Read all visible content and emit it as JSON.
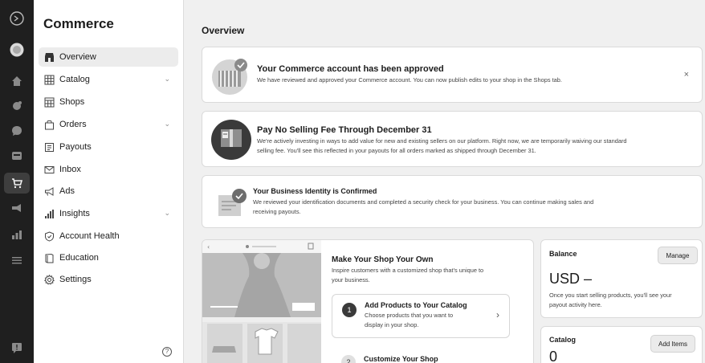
{
  "nav": {
    "title": "Commerce",
    "items": [
      {
        "label": "Overview",
        "icon": "store-icon"
      },
      {
        "label": "Catalog",
        "icon": "grid-icon"
      },
      {
        "label": "Shops",
        "icon": "shop-grid-icon"
      },
      {
        "label": "Orders",
        "icon": "bag-icon"
      },
      {
        "label": "Payouts",
        "icon": "payouts-icon"
      },
      {
        "label": "Inbox",
        "icon": "mail-icon"
      },
      {
        "label": "Ads",
        "icon": "megaphone-icon"
      },
      {
        "label": "Insights",
        "icon": "bar-chart-icon"
      },
      {
        "label": "Account Health",
        "icon": "shield-icon"
      },
      {
        "label": "Education",
        "icon": "book-icon"
      },
      {
        "label": "Settings",
        "icon": "gear-icon"
      }
    ],
    "help_glyph": "?"
  },
  "main": {
    "title": "Overview",
    "approved": {
      "title": "Your Commerce account has been approved",
      "body": "We have reviewed and approved your Commerce account. You can now publish edits to your shop in the Shops tab.",
      "close": "×"
    },
    "fee": {
      "title": "Pay No Selling Fee Through December 31",
      "body1": "We're actively investing in ways to add value for new and existing sellers on our platform. Right now, we are temporarily waiving our standard",
      "body2": "selling fee. You'll see this reflected in your payouts for all orders marked as shipped through December 31."
    },
    "identity": {
      "title": "Your Business Identity is Confirmed",
      "body1": "We reviewed your identification documents and completed a security check for your business. You can continue making sales and",
      "body2": "receiving payouts."
    },
    "shop": {
      "title": "Make Your Shop Your Own",
      "body1": "Inspire customers with a customized shop that's unique to",
      "body2": "your business.",
      "steps": [
        {
          "num": "1",
          "title": "Add Products to Your Catalog",
          "body1": "Choose products that you want to",
          "body2": "display in your shop."
        },
        {
          "num": "2",
          "title": "Customize Your Shop"
        }
      ]
    },
    "balance": {
      "title": "Balance",
      "button": "Manage",
      "amount": "USD –",
      "body1": "Once you start selling products, you'll see your",
      "body2": "payout activity here."
    },
    "catalog": {
      "title": "Catalog",
      "button": "Add Items",
      "count": "0"
    }
  }
}
